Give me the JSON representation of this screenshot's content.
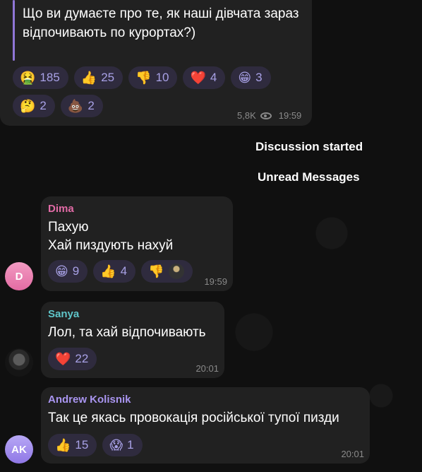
{
  "post": {
    "text": "Що ви думаєте про те, як наші дівчата зараз відпочивають по курортах?)",
    "reactions": [
      {
        "emoji": "🤮",
        "count": "185"
      },
      {
        "emoji": "👍",
        "count": "25"
      },
      {
        "emoji": "👎",
        "count": "10"
      },
      {
        "emoji": "❤️",
        "count": "4"
      },
      {
        "emoji": "😁",
        "count": "3"
      },
      {
        "emoji": "🤔",
        "count": "2"
      },
      {
        "emoji": "💩",
        "count": "2"
      }
    ],
    "views": "5,8K",
    "time": "19:59"
  },
  "service": {
    "discussion": "Discussion started",
    "unread": "Unread Messages"
  },
  "messages": [
    {
      "sender": "Dima",
      "sender_color": "#e26ba6",
      "avatar_text": "D",
      "lines": [
        "Пахую",
        "Хай пиздують нахуй"
      ],
      "reactions": [
        {
          "emoji": "😁",
          "count": "9"
        },
        {
          "emoji": "👍",
          "count": "4"
        },
        {
          "emoji": "👎",
          "count": ""
        }
      ],
      "time": "19:59"
    },
    {
      "sender": "Sanya",
      "sender_color": "#5fc5c9",
      "avatar_text": "",
      "lines": [
        "Лол, та хай відпочивають"
      ],
      "reactions": [
        {
          "emoji": "❤️",
          "count": "22"
        }
      ],
      "time": "20:01"
    },
    {
      "sender": "Andrew Kolisnik",
      "sender_color": "#a995f0",
      "avatar_text": "AK",
      "lines": [
        "Так це якась провокація російської тупої пизди"
      ],
      "reactions": [
        {
          "emoji": "👍",
          "count": "15"
        },
        {
          "emoji": "😱",
          "count": "1"
        }
      ],
      "time": "20:01"
    }
  ]
}
